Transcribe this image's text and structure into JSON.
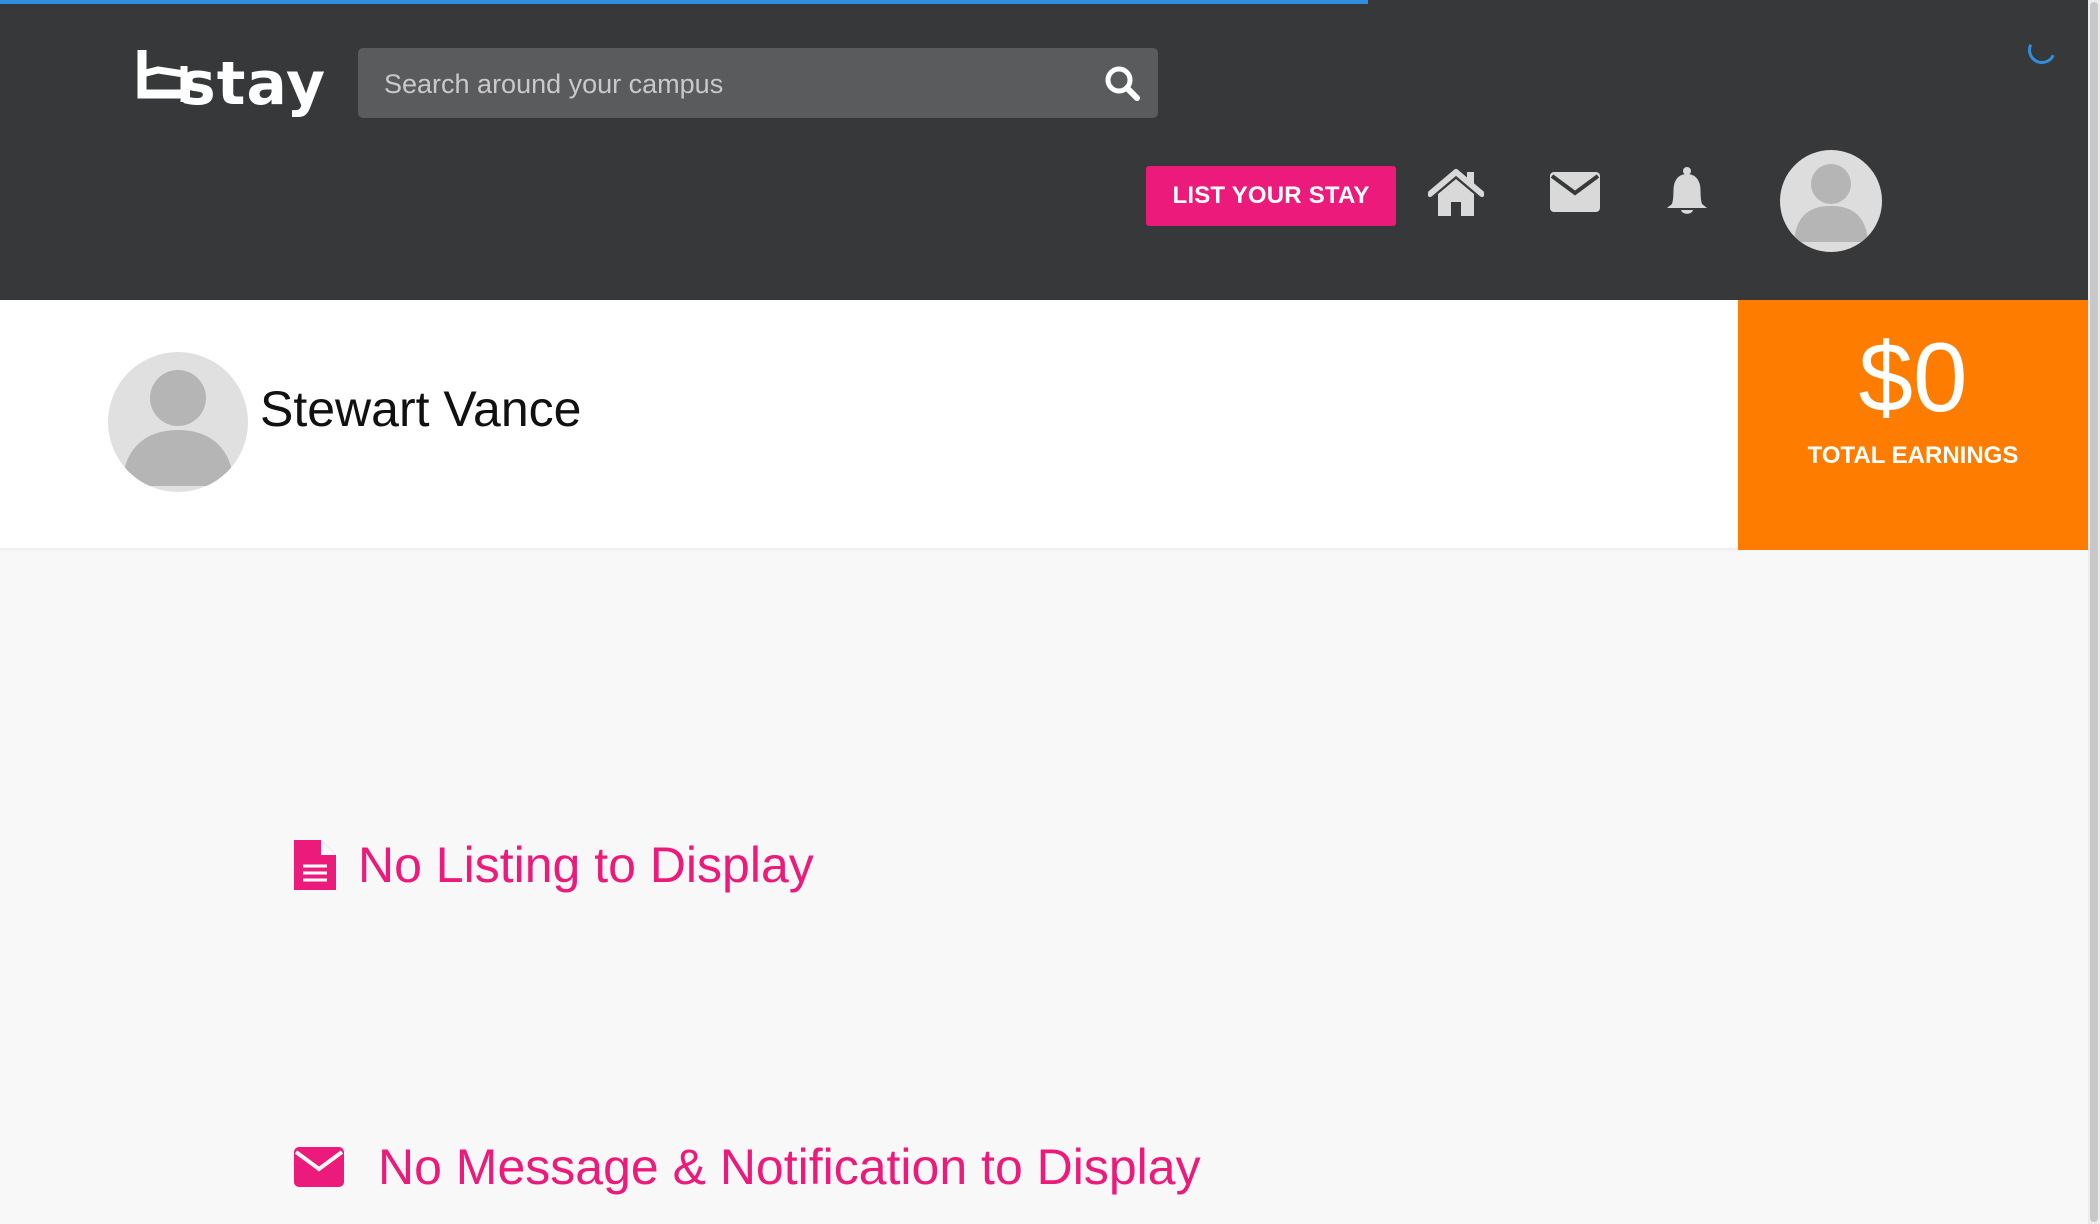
{
  "header": {
    "logo_text": "stay",
    "search": {
      "placeholder": "Search around your campus",
      "value": ""
    },
    "list_button_label": "LIST YOUR STAY",
    "icons": [
      "search-icon",
      "home-icon",
      "mail-icon",
      "bell-icon",
      "avatar-icon",
      "loading-spinner-icon"
    ]
  },
  "profile": {
    "name": "Stewart Vance"
  },
  "earnings": {
    "value": "$0",
    "label": "TOTAL EARNINGS"
  },
  "empty_states": {
    "listings": "No Listing to Display",
    "messages": "No Message & Notification to Display"
  },
  "colors": {
    "header_bg": "#373839",
    "accent_pink": "#ec1a7a",
    "earnings_orange": "#fe7d00",
    "progress_blue": "#2f8fde"
  }
}
